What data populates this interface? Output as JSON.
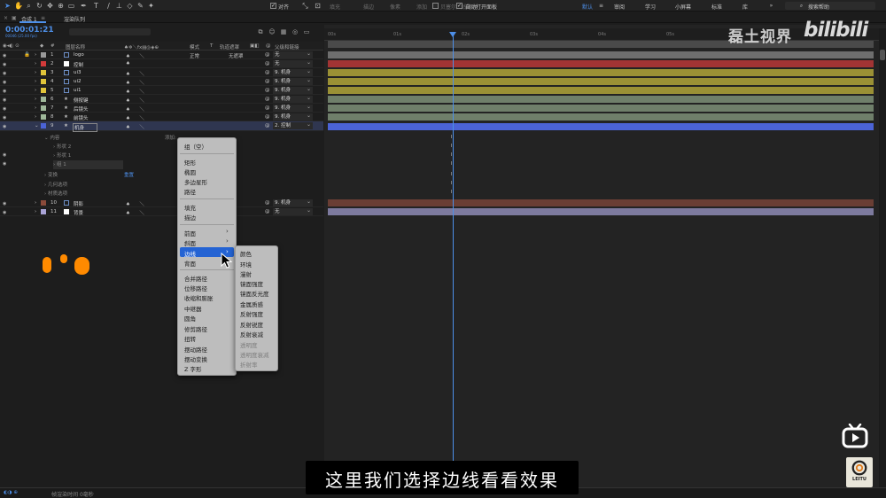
{
  "toolbar": {
    "align_label": "对齐",
    "fill_label": "填充",
    "stroke_label": "描边",
    "pixels_label": "像素",
    "add_label": "添加",
    "bezier_label": "贝塞尔曲线路径",
    "auto_open_label": "自动打开面板",
    "workspaces": [
      "默认",
      "审阅",
      "学习",
      "小屏幕",
      "标准",
      "库"
    ],
    "search_label": "搜索帮助"
  },
  "tabs": {
    "comp_tab": "合成 1",
    "render_tab": "渲染队列"
  },
  "timeline": {
    "timecode": "0:00:01:21",
    "timecode_sub": "00046 (25.00 fps)",
    "ruler_ticks": [
      "00s",
      "01s",
      "02s",
      "03s",
      "04s",
      "05s"
    ]
  },
  "columns": {
    "layer_name": "图层名称",
    "mode": "模式",
    "track_matte_t": "T",
    "track_matte": "轨道遮罩",
    "parent": "父级和链接",
    "hash": "#"
  },
  "layers": [
    {
      "num": "1",
      "name": "logo",
      "color": "#9a9a9a",
      "mode": "正常",
      "matte": "无遮罩",
      "parent": "无"
    },
    {
      "num": "2",
      "name": "控制",
      "color": "#d23a3a",
      "mode": "",
      "matte": "",
      "parent": "无"
    },
    {
      "num": "3",
      "name": "ui3",
      "color": "#e0c43a",
      "mode": "",
      "matte": "",
      "parent": "9. 机身"
    },
    {
      "num": "4",
      "name": "ui2",
      "color": "#e0c43a",
      "mode": "",
      "matte": "",
      "parent": "9. 机身"
    },
    {
      "num": "5",
      "name": "ui1",
      "color": "#e0c43a",
      "mode": "",
      "matte": "",
      "parent": "9. 机身"
    },
    {
      "num": "6",
      "name": "侧按键",
      "color": "#9fb89a",
      "mode": "",
      "matte": "",
      "parent": "9. 机身"
    },
    {
      "num": "7",
      "name": "后镜头",
      "color": "#9fb89a",
      "mode": "",
      "matte": "",
      "parent": "9. 机身"
    },
    {
      "num": "8",
      "name": "前镜头",
      "color": "#9fb89a",
      "mode": "",
      "matte": "",
      "parent": "9. 机身"
    },
    {
      "num": "9",
      "name": "机身",
      "color": "#4b63d6",
      "mode": "",
      "matte": "",
      "parent": "2. 控制"
    }
  ],
  "sub_rows": {
    "content": "内容",
    "add": "添加:",
    "shape2": "形状 2",
    "shape1": "形状 1",
    "group1": "组 1",
    "transform": "变换",
    "transform_value": "重置",
    "geometry": "几何选项",
    "material": "材质选项"
  },
  "layers_bottom": [
    {
      "num": "10",
      "name": "阴影",
      "color": "#8a4a3a",
      "parent": "9. 机身"
    },
    {
      "num": "11",
      "name": "背景",
      "color": "#a9a3d6",
      "parent": "无"
    }
  ],
  "context_menu": {
    "items_group1": [
      "组（空）"
    ],
    "items_group2": [
      "矩形",
      "椭圆",
      "多边星形",
      "路径"
    ],
    "items_group3": [
      "填充",
      "描边"
    ],
    "items_group4": [
      "前面",
      "斜面",
      "边线",
      "背面"
    ],
    "items_group5": [
      "合并路径",
      "位移路径",
      "收缩和膨胀",
      "中继器",
      "圆角",
      "修剪路径",
      "扭转",
      "摆动路径",
      "摆动变换",
      "Z 字形"
    ]
  },
  "submenu": {
    "enabled": [
      "颜色",
      "环境",
      "漫射",
      "镜面强度",
      "镜面反光度",
      "金属质感",
      "反射强度",
      "反射锐度",
      "反射衰减"
    ],
    "disabled": [
      "透明度",
      "透明度衰减",
      "折射率"
    ]
  },
  "bottom": {
    "frame_render": "帧渲染时间",
    "frame_value": "0毫秒"
  },
  "overlay": {
    "channel_name": "磊土视界",
    "bilibili_logo": "bilibili",
    "subtitle": "这里我们选择边线看看效果",
    "leitu_label": "LEITU"
  },
  "colors": {
    "accent": "#4d8fe8",
    "menu_highlight": "#2463d3",
    "menu_bg": "#bdbdbd"
  }
}
